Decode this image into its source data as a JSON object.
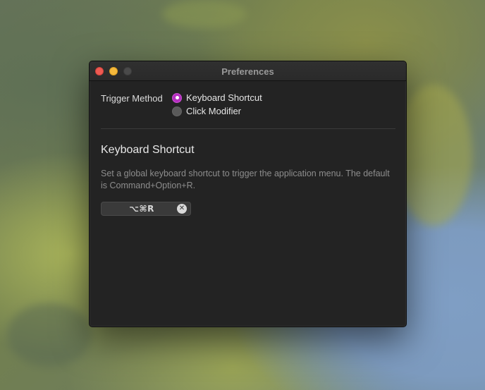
{
  "window": {
    "title": "Preferences"
  },
  "trigger": {
    "label": "Trigger Method",
    "options": [
      {
        "label": "Keyboard Shortcut",
        "selected": true
      },
      {
        "label": "Click Modifier",
        "selected": false
      }
    ]
  },
  "section": {
    "title": "Keyboard Shortcut",
    "description": "Set a global keyboard shortcut to trigger the application menu. The default is Command+Option+R."
  },
  "shortcut": {
    "value": "⌥⌘R",
    "clear_glyph": "✕"
  },
  "colors": {
    "accent": "#b62fc0",
    "window_bg": "#232323",
    "close": "#ee5a52",
    "minimize": "#f5b93c"
  }
}
